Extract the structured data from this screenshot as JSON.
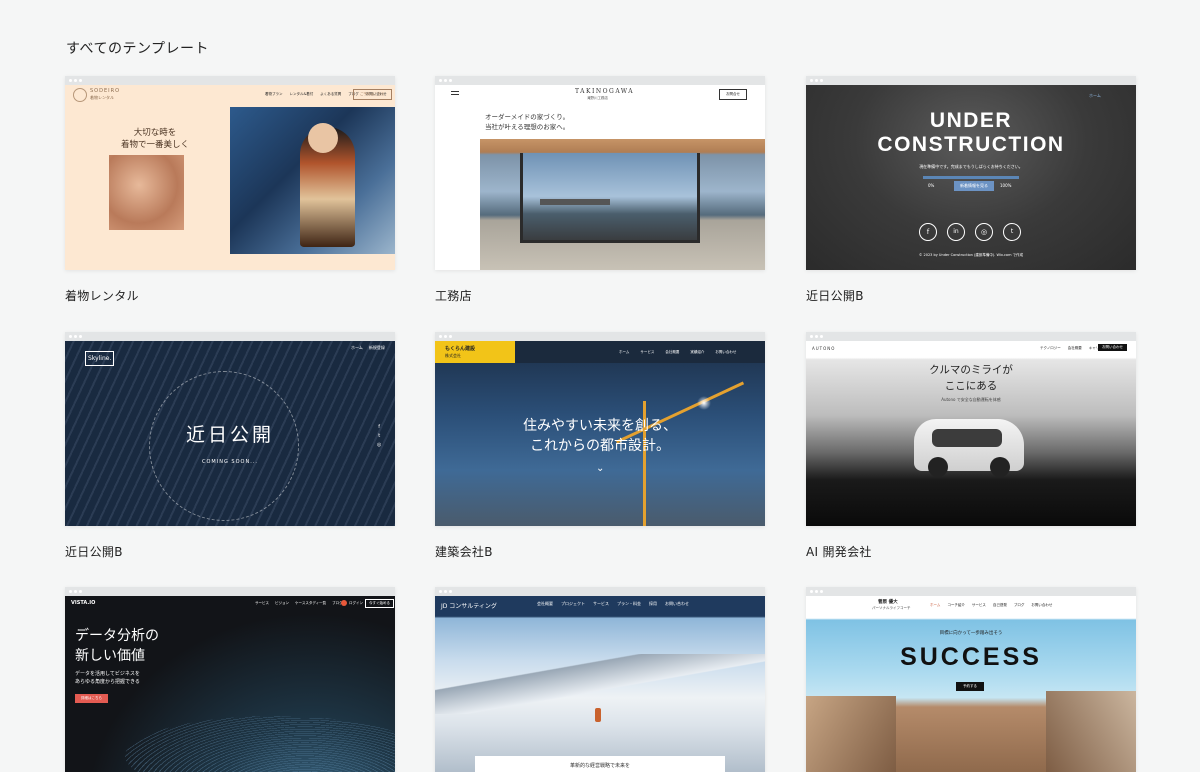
{
  "section_title": "すべてのテンプレート",
  "templates": [
    {
      "label": "着物レンタル",
      "logo": "SODEIRO",
      "logo_sub": "着物レンタル",
      "nav": [
        "着物プラン",
        "レンタル&着付",
        "よくある質問",
        "ブログ",
        "お問い合わせ"
      ],
      "cta": "ご予約はこちら",
      "headline": [
        "大切な時を",
        "着物で一番美しく"
      ]
    },
    {
      "label": "工務店",
      "logo": "TAKINOGAWA",
      "logo_sub": "滝野川工務店",
      "cta": "お問合せ",
      "headline": [
        "オーダーメイドの家づくり。",
        "当社が叶える理想のお家へ。"
      ]
    },
    {
      "label": "近日公開B",
      "nav": "ホーム",
      "headline": [
        "UNDER",
        "CONSTRUCTION"
      ],
      "sub": "現在準備中です。完成までもうしばらくお待ちください。",
      "progress_start": "0%",
      "progress_button": "新着情報を見る",
      "progress_end": "100%",
      "footer": "© 2023 by Under Construction (建設準備中). Wix.com で作成"
    },
    {
      "label": "近日公開B",
      "logo": "Skyline.",
      "nav": [
        "ホーム",
        "新規登録"
      ],
      "headline": "近日公開",
      "sub": "COMING SOON..."
    },
    {
      "label": "建築会社B",
      "logo": [
        "もくらん建設",
        "株式会社"
      ],
      "nav": [
        "ホーム",
        "サービス",
        "会社概要",
        "実績紹介",
        "お問い合わせ"
      ],
      "headline": [
        "住みやすい未来を創る、",
        "これからの都市設計。"
      ]
    },
    {
      "label": "AI 開発会社",
      "logo": "AUTONO",
      "nav": [
        "テクノロジー",
        "会社概要",
        "キャリア"
      ],
      "cta": "お問い合わせ",
      "headline": [
        "クルマのミライが",
        "ここにある"
      ],
      "sub": "Autono で安全な自動運転を体感"
    },
    {
      "logo": "VISTA.IO",
      "nav": [
        "サービス",
        "ビジョン",
        "ケーススタディ一覧",
        "ブログ"
      ],
      "login": "ログイン",
      "cta": "今すぐ始める",
      "headline": [
        "データ分析の",
        "新しい価値"
      ],
      "sub": [
        "データを活用してビジネスを",
        "あらゆる角度から把握できる"
      ],
      "button": "詳細はこちら"
    },
    {
      "logo": "JD コンサルティング",
      "nav": [
        "会社概要",
        "プロジェクト",
        "サービス",
        "プラン・料金",
        "採用",
        "お問い合わせ"
      ],
      "caption": "革新的な経営戦略で未来を"
    },
    {
      "logo": "菅原 優大",
      "logo_sub": "パーソナルライフコーチ",
      "nav": [
        "ホーム",
        "コーチ紹介",
        "サービス",
        "自己啓発",
        "ブログ",
        "お問い合わせ"
      ],
      "kicker": "目標に向かって一歩踏み出そう",
      "headline": "SUCCESS",
      "button": "予約する"
    }
  ]
}
